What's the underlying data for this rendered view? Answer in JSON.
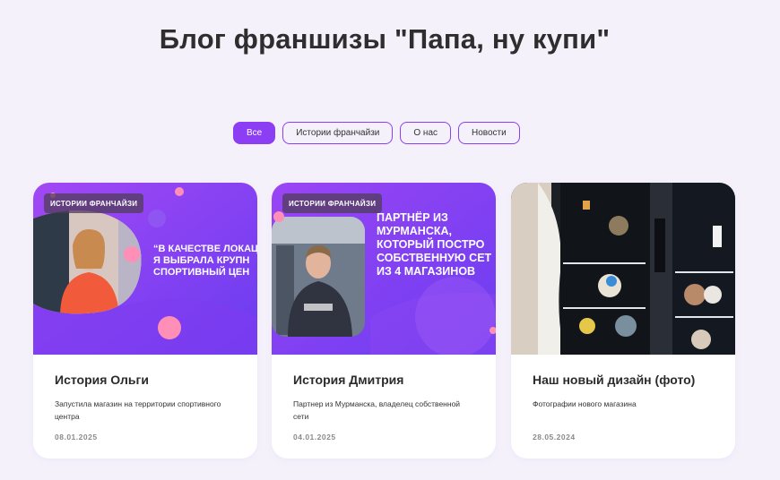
{
  "page": {
    "title": "Блог франшизы \"Папа, ну купи\""
  },
  "filters": [
    {
      "label": "Все",
      "active": true
    },
    {
      "label": "Истории франчайзи",
      "active": false
    },
    {
      "label": "О нас",
      "active": false
    },
    {
      "label": "Новости",
      "active": false
    }
  ],
  "colors": {
    "accent": "#8b3ef4",
    "background": "#f5f1fb",
    "card": "#ffffff"
  },
  "cards": [
    {
      "badge": "ИСТОРИИ ФРАНЧАЙЗИ",
      "image_text": "“В КАЧЕСТВЕ ЛОКАЦ\nЯ ВЫБРАЛА КРУПН\nСПОРТИВНЫЙ ЦЕН",
      "title": "История Ольги",
      "description": "Запустила магазин на территории спортивного центра",
      "date": "08.01.2025"
    },
    {
      "badge": "ИСТОРИИ ФРАНЧАЙЗИ",
      "image_text": "ПАРТНЁР ИЗ\nМУРМАНСКА,\nКОТОРЫЙ ПОСТРО\nСОБСТВЕННУЮ СЕТ\nИЗ 4 МАГАЗИНОВ",
      "title": "История Дмитрия",
      "description": "Партнер из Мурманска, владелец собственной сети",
      "date": "04.01.2025"
    },
    {
      "badge": "",
      "image_text": "",
      "title": "Наш новый дизайн (фото)",
      "description": "Фотографии нового магазина",
      "date": "28.05.2024"
    }
  ]
}
